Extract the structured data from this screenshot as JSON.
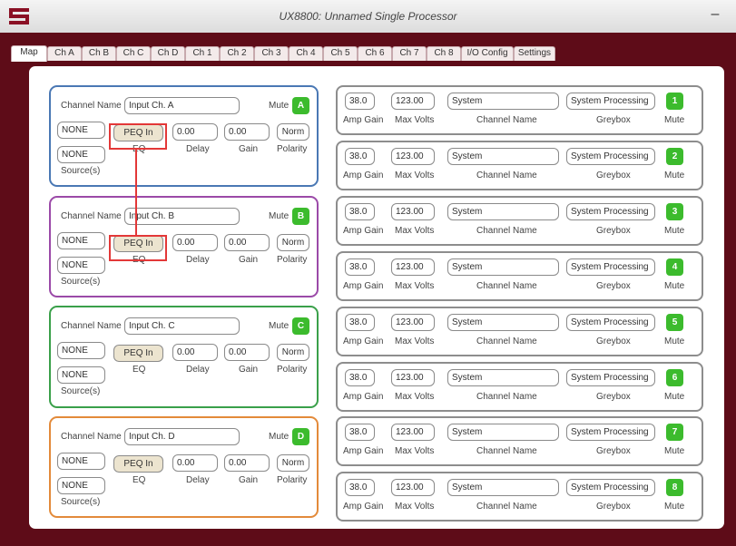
{
  "app": {
    "title": "UX8800: Unnamed Single Processor",
    "minimize": "–"
  },
  "tabs": [
    "Map",
    "Ch A",
    "Ch B",
    "Ch C",
    "Ch D",
    "Ch 1",
    "Ch 2",
    "Ch 3",
    "Ch 4",
    "Ch 5",
    "Ch 6",
    "Ch 7",
    "Ch 8",
    "I/O Config",
    "Settings"
  ],
  "active_tab": "Map",
  "input_channels": [
    {
      "channel_name_label": "Channel Name",
      "name": "Input Ch. A",
      "mute_label": "Mute",
      "mute": "A",
      "src1": "NONE",
      "src2": "NONE",
      "sources_label": "Source(s)",
      "eq": "PEQ In",
      "eq_label": "EQ",
      "delay": "0.00",
      "delay_label": "Delay",
      "gain": "0.00",
      "gain_label": "Gain",
      "polarity": "Norm",
      "polarity_label": "Polarity",
      "color": "#4a78b4"
    },
    {
      "channel_name_label": "Channel Name",
      "name": "Input Ch. B",
      "mute_label": "Mute",
      "mute": "B",
      "src1": "NONE",
      "src2": "NONE",
      "sources_label": "Source(s)",
      "eq": "PEQ In",
      "eq_label": "EQ",
      "delay": "0.00",
      "delay_label": "Delay",
      "gain": "0.00",
      "gain_label": "Gain",
      "polarity": "Norm",
      "polarity_label": "Polarity",
      "color": "#9b4aa8"
    },
    {
      "channel_name_label": "Channel Name",
      "name": "Input Ch. C",
      "mute_label": "Mute",
      "mute": "C",
      "src1": "NONE",
      "src2": "NONE",
      "sources_label": "Source(s)",
      "eq": "PEQ In",
      "eq_label": "EQ",
      "delay": "0.00",
      "delay_label": "Delay",
      "gain": "0.00",
      "gain_label": "Gain",
      "polarity": "Norm",
      "polarity_label": "Polarity",
      "color": "#3aa04a"
    },
    {
      "channel_name_label": "Channel Name",
      "name": "Input Ch. D",
      "mute_label": "Mute",
      "mute": "D",
      "src1": "NONE",
      "src2": "NONE",
      "sources_label": "Source(s)",
      "eq": "PEQ In",
      "eq_label": "EQ",
      "delay": "0.00",
      "delay_label": "Delay",
      "gain": "0.00",
      "gain_label": "Gain",
      "polarity": "Norm",
      "polarity_label": "Polarity",
      "color": "#e38a3a"
    }
  ],
  "output_channels": [
    {
      "amp_gain": "38.0",
      "amp_gain_label": "Amp Gain",
      "max_volts": "123.00",
      "max_volts_label": "Max Volts",
      "name": "System",
      "name_label": "Channel Name",
      "greybox": "System Processing",
      "greybox_label": "Greybox",
      "mute": "1",
      "mute_label": "Mute"
    },
    {
      "amp_gain": "38.0",
      "amp_gain_label": "Amp Gain",
      "max_volts": "123.00",
      "max_volts_label": "Max Volts",
      "name": "System",
      "name_label": "Channel Name",
      "greybox": "System Processing",
      "greybox_label": "Greybox",
      "mute": "2",
      "mute_label": "Mute"
    },
    {
      "amp_gain": "38.0",
      "amp_gain_label": "Amp Gain",
      "max_volts": "123.00",
      "max_volts_label": "Max Volts",
      "name": "System",
      "name_label": "Channel Name",
      "greybox": "System Processing",
      "greybox_label": "Greybox",
      "mute": "3",
      "mute_label": "Mute"
    },
    {
      "amp_gain": "38.0",
      "amp_gain_label": "Amp Gain",
      "max_volts": "123.00",
      "max_volts_label": "Max Volts",
      "name": "System",
      "name_label": "Channel Name",
      "greybox": "System Processing",
      "greybox_label": "Greybox",
      "mute": "4",
      "mute_label": "Mute"
    },
    {
      "amp_gain": "38.0",
      "amp_gain_label": "Amp Gain",
      "max_volts": "123.00",
      "max_volts_label": "Max Volts",
      "name": "System",
      "name_label": "Channel Name",
      "greybox": "System Processing",
      "greybox_label": "Greybox",
      "mute": "5",
      "mute_label": "Mute"
    },
    {
      "amp_gain": "38.0",
      "amp_gain_label": "Amp Gain",
      "max_volts": "123.00",
      "max_volts_label": "Max Volts",
      "name": "System",
      "name_label": "Channel Name",
      "greybox": "System Processing",
      "greybox_label": "Greybox",
      "mute": "6",
      "mute_label": "Mute"
    },
    {
      "amp_gain": "38.0",
      "amp_gain_label": "Amp Gain",
      "max_volts": "123.00",
      "max_volts_label": "Max Volts",
      "name": "System",
      "name_label": "Channel Name",
      "greybox": "System Processing",
      "greybox_label": "Greybox",
      "mute": "7",
      "mute_label": "Mute"
    },
    {
      "amp_gain": "38.0",
      "amp_gain_label": "Amp Gain",
      "max_volts": "123.00",
      "max_volts_label": "Max Volts",
      "name": "System",
      "name_label": "Channel Name",
      "greybox": "System Processing",
      "greybox_label": "Greybox",
      "mute": "8",
      "mute_label": "Mute"
    }
  ],
  "colors": {
    "frame": "#5e0c18",
    "mute_active": "#3cbb2d",
    "highlight": "#e33838"
  }
}
